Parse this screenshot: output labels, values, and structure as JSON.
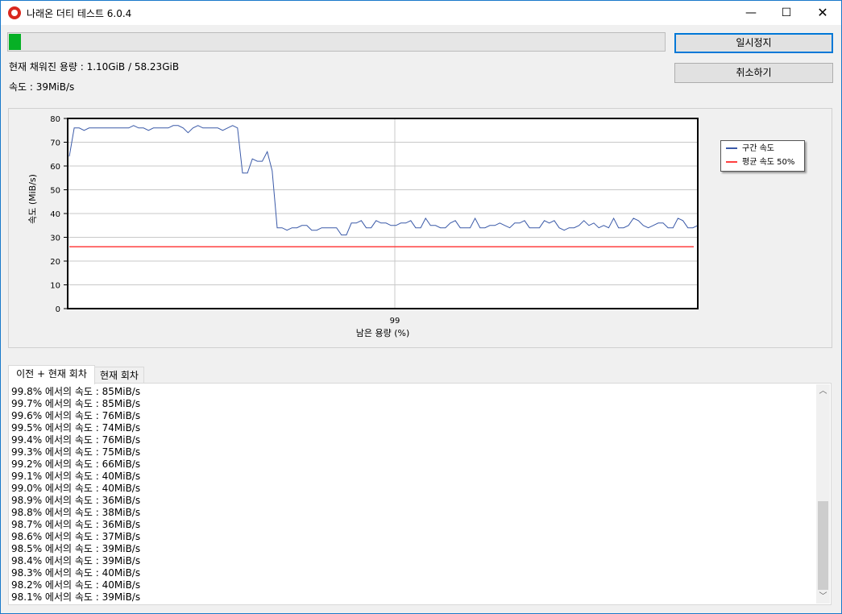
{
  "window": {
    "title": "나래온 더티 테스트 6.0.4",
    "controls": {
      "minimize": "—",
      "maximize": "☐",
      "close": "✕"
    }
  },
  "progress": {
    "fraction": 0.019,
    "color": "#06b025"
  },
  "status": {
    "filled": "현재 채워진 용량 : 1.10GiB / 58.23GiB",
    "speed": "속도 : 39MiB/s"
  },
  "buttons": {
    "pause": "일시정지",
    "cancel": "취소하기"
  },
  "chart_data": {
    "type": "line",
    "xlabel": "남은 용량 (%)",
    "ylabel": "속도 (MiB/s)",
    "ylim": [
      0,
      80
    ],
    "yticks": [
      "0",
      "10",
      "20",
      "30",
      "40",
      "50",
      "60",
      "70",
      "80"
    ],
    "xtick_label": "99",
    "grid": true,
    "legend_position": "top-right",
    "series": [
      {
        "name": "구간 속도",
        "color": "#3b5aa8",
        "values": [
          64,
          76,
          76,
          75,
          76,
          76,
          76,
          76,
          76,
          76,
          76,
          76,
          76,
          77,
          76,
          76,
          75,
          76,
          76,
          76,
          76,
          77,
          77,
          76,
          74,
          76,
          77,
          76,
          76,
          76,
          76,
          75,
          76,
          77,
          76,
          57,
          57,
          63,
          62,
          62,
          66,
          58,
          34,
          34,
          33,
          34,
          34,
          35,
          35,
          33,
          33,
          34,
          34,
          34,
          34,
          31,
          31,
          36,
          36,
          37,
          34,
          34,
          37,
          36,
          36,
          35,
          35,
          36,
          36,
          37,
          34,
          34,
          38,
          35,
          35,
          34,
          34,
          36,
          37,
          34,
          34,
          34,
          38,
          34,
          34,
          35,
          35,
          36,
          35,
          34,
          36,
          36,
          37,
          34,
          34,
          34,
          37,
          36,
          37,
          34,
          33,
          34,
          34,
          35,
          37,
          35,
          36,
          34,
          35,
          34,
          38,
          34,
          34,
          35,
          38,
          37,
          35,
          34,
          35,
          36,
          36,
          34,
          34,
          38,
          37,
          34,
          34,
          35
        ]
      },
      {
        "name": "평균 속도 50%",
        "color": "#ff4040",
        "values": [
          26,
          26
        ]
      }
    ]
  },
  "tabs": [
    {
      "label": "이전 + 현재 회차"
    },
    {
      "label": "현재 회차"
    }
  ],
  "log_lines": [
    "99.8% 에서의 속도 : 85MiB/s",
    "99.7% 에서의 속도 : 85MiB/s",
    "99.6% 에서의 속도 : 76MiB/s",
    "99.5% 에서의 속도 : 74MiB/s",
    "99.4% 에서의 속도 : 76MiB/s",
    "99.3% 에서의 속도 : 75MiB/s",
    "99.2% 에서의 속도 : 66MiB/s",
    "99.1% 에서의 속도 : 40MiB/s",
    "99.0% 에서의 속도 : 40MiB/s",
    "98.9% 에서의 속도 : 36MiB/s",
    "98.8% 에서의 속도 : 38MiB/s",
    "98.7% 에서의 속도 : 36MiB/s",
    "98.6% 에서의 속도 : 37MiB/s",
    "98.5% 에서의 속도 : 39MiB/s",
    "98.4% 에서의 속도 : 39MiB/s",
    "98.3% 에서의 속도 : 40MiB/s",
    "98.2% 에서의 속도 : 40MiB/s",
    "98.1% 에서의 속도 : 39MiB/s"
  ]
}
